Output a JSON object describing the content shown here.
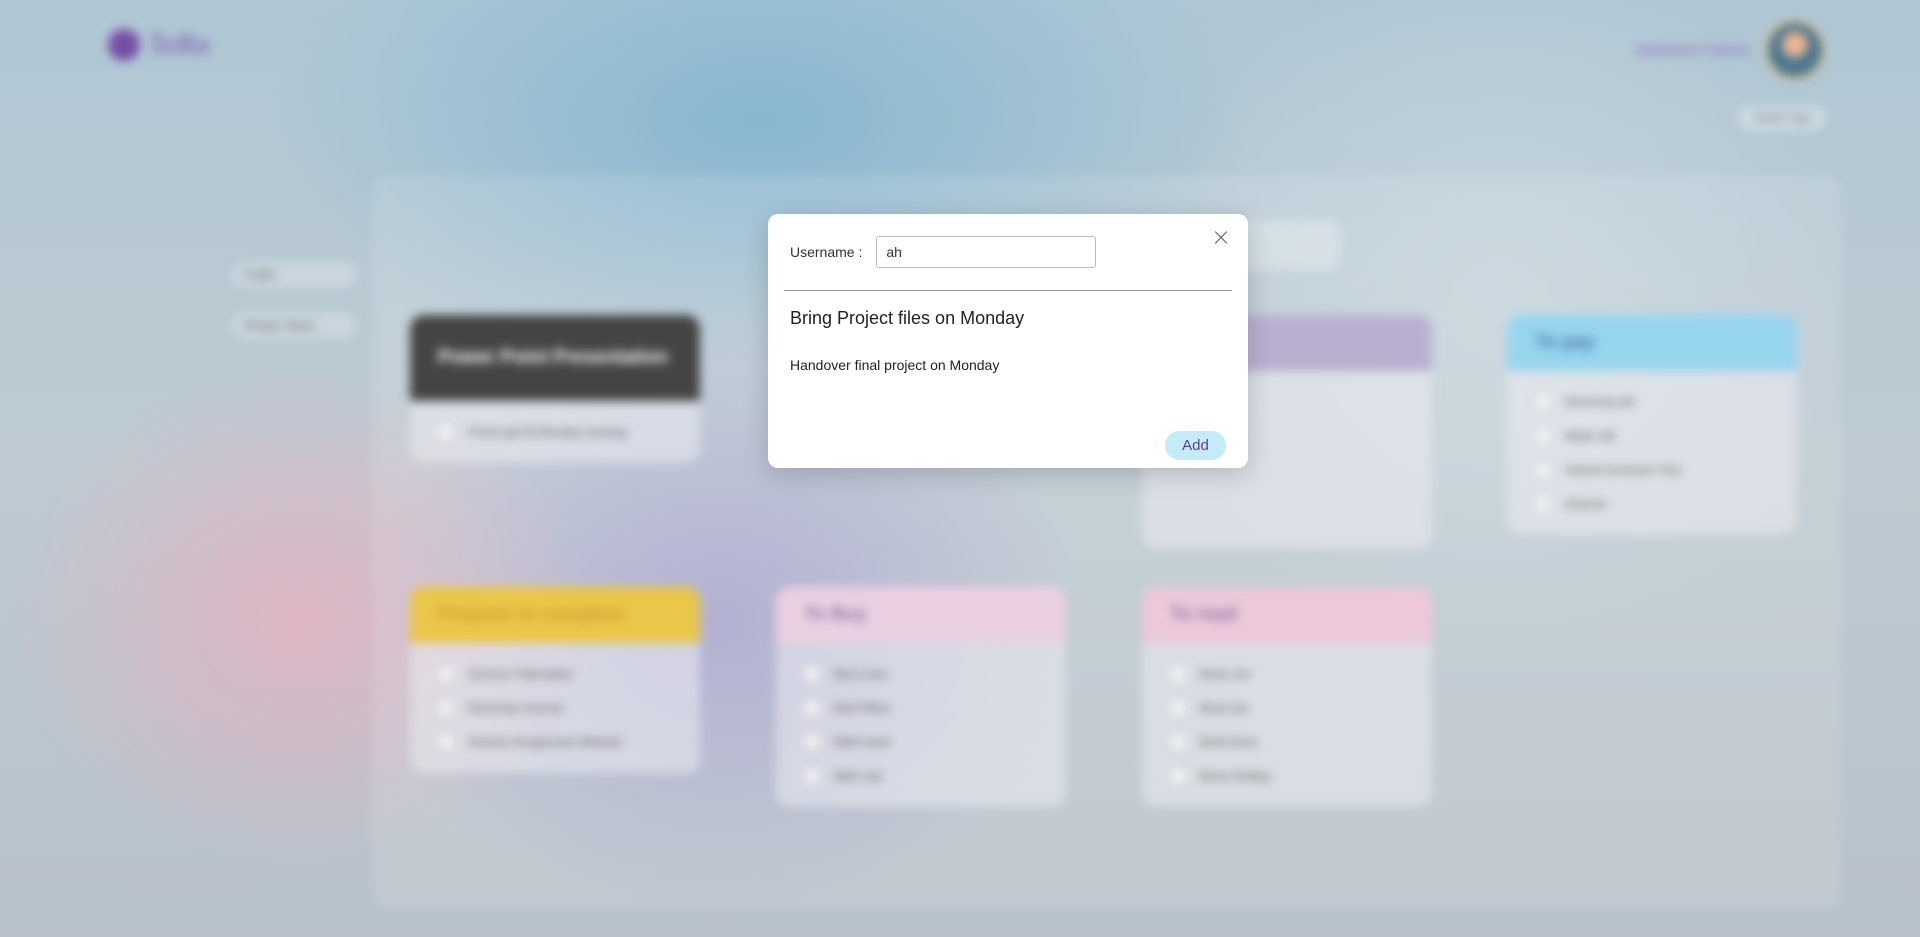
{
  "app": {
    "logo_text": "TeRe",
    "user_name": "Ahdneem Fakroo",
    "top_button": "Switch Type"
  },
  "sidebar": {
    "items": [
      {
        "label": "Public"
      },
      {
        "label": "Design Steps"
      }
    ]
  },
  "board": {
    "cards": [
      {
        "title": "Power Point Presentation",
        "header_color": "#3a3a3a",
        "items": [
          "Finish ppt till Monday evening"
        ]
      },
      {
        "title": "To pay",
        "header_color": "#8fd2ee",
        "items": [
          "Electricity bill",
          "Water bill",
          "Vehicle Emission Test",
          "Internet"
        ]
      },
      {
        "title": "Projects to complete",
        "header_color": "#e9c23a",
        "items": [
          "Science Fabrication",
          "Electricity Journal",
          "Science Assignment Website"
        ]
      },
      {
        "title": "To Buy",
        "header_color": "#e9cde0",
        "items": [
          "Bed Linen",
          "Bed Pillow",
          "Bath towel",
          "Bath mat"
        ]
      },
      {
        "title": "To read",
        "header_color": "#ebc4d6",
        "items": [
          "Book one",
          "Book two",
          "Book three",
          "Book Holiday"
        ]
      }
    ]
  },
  "modal": {
    "username_label": "Username :",
    "username_value": "ah",
    "task_title": "Bring Project files on Monday",
    "task_description": "Handover final project on Monday",
    "add_label": "Add",
    "close_symbol": "×"
  }
}
